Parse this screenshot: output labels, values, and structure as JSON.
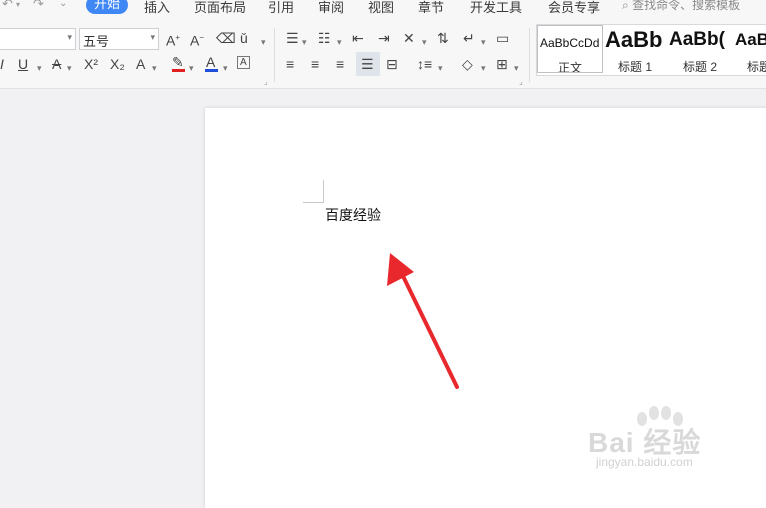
{
  "menu": {
    "tabs": [
      {
        "label": "开始",
        "active": true
      },
      {
        "label": "插入"
      },
      {
        "label": "页面布局"
      },
      {
        "label": "引用"
      },
      {
        "label": "审阅"
      },
      {
        "label": "视图"
      },
      {
        "label": "章节"
      },
      {
        "label": "开发工具"
      },
      {
        "label": "会员专享"
      }
    ],
    "search_placeholder": "查找命令、搜索模板"
  },
  "ribbon": {
    "font_name": "",
    "font_size": "五号"
  },
  "styles": [
    {
      "preview": "AaBbCcDd",
      "label": "正文",
      "selected": true
    },
    {
      "preview": "AaBb",
      "label": "标题 1"
    },
    {
      "preview": "AaBb(",
      "label": "标题 2"
    },
    {
      "preview": "AaB",
      "label": "标题"
    }
  ],
  "document": {
    "text": "百度经验"
  },
  "watermark": {
    "brand": "Bai 经验",
    "url": "jingyan.baidu.com"
  },
  "colors": {
    "accent": "#3f87f5",
    "font_color_bar": "#1f4fd8",
    "highlight_bar": "#e02020",
    "arrow": "#e8282c"
  }
}
